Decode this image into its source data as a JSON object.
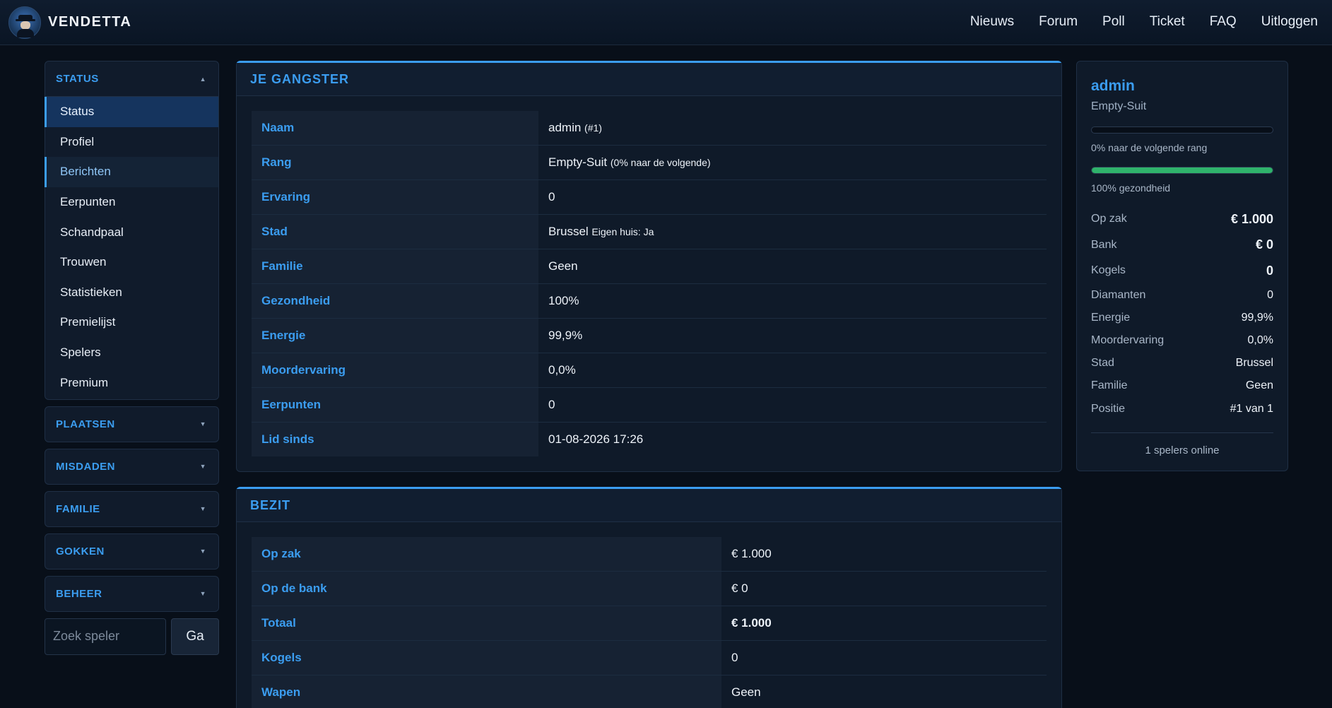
{
  "header": {
    "brand": "VENDETTA",
    "nav": [
      "Nieuws",
      "Forum",
      "Poll",
      "Ticket",
      "FAQ",
      "Uitloggen"
    ]
  },
  "sidebar": {
    "status": {
      "title": "STATUS",
      "items": [
        "Status",
        "Profiel",
        "Berichten",
        "Eerpunten",
        "Schandpaal",
        "Trouwen",
        "Statistieken",
        "Premielijst",
        "Spelers",
        "Premium"
      ]
    },
    "sections": [
      "PLAATSEN",
      "MISDADEN",
      "FAMILIE",
      "GOKKEN",
      "BEHEER"
    ],
    "search": {
      "placeholder": "Zoek speler",
      "button": "Ga"
    }
  },
  "gangster": {
    "title": "JE GANGSTER",
    "rows": [
      {
        "key": "Naam",
        "value": "admin",
        "note": "(#1)"
      },
      {
        "key": "Rang",
        "value": "Empty-Suit",
        "note": "(0% naar de volgende)"
      },
      {
        "key": "Ervaring",
        "value": "0",
        "note": ""
      },
      {
        "key": "Stad",
        "value": "Brussel",
        "note": "Eigen huis: Ja"
      },
      {
        "key": "Familie",
        "value": "Geen",
        "note": ""
      },
      {
        "key": "Gezondheid",
        "value": "100%",
        "note": ""
      },
      {
        "key": "Energie",
        "value": "99,9%",
        "note": ""
      },
      {
        "key": "Moordervaring",
        "value": "0,0%",
        "note": ""
      },
      {
        "key": "Eerpunten",
        "value": "0",
        "note": ""
      },
      {
        "key": "Lid sinds",
        "value": "01-08-2026 17:26",
        "note": ""
      }
    ]
  },
  "bezit": {
    "title": "BEZIT",
    "rows": [
      {
        "key": "Op zak",
        "value": "€ 1.000"
      },
      {
        "key": "Op de bank",
        "value": "€ 0"
      },
      {
        "key": "Totaal",
        "value": "€ 1.000"
      },
      {
        "key": "Kogels",
        "value": "0"
      },
      {
        "key": "Wapen",
        "value": "Geen"
      }
    ]
  },
  "profile": {
    "name": "admin",
    "rank": "Empty-Suit",
    "rank_progress": 0,
    "rank_label": "0% naar de volgende rang",
    "health": 100,
    "health_label": "100% gezondheid",
    "stats": [
      {
        "key": "Op zak",
        "value": "€ 1.000"
      },
      {
        "key": "Bank",
        "value": "€ 0"
      },
      {
        "key": "Kogels",
        "value": "0"
      },
      {
        "key": "Diamanten",
        "value": "0"
      },
      {
        "key": "Energie",
        "value": "99,9%"
      },
      {
        "key": "Moordervaring",
        "value": "0,0%"
      },
      {
        "key": "Stad",
        "value": "Brussel"
      },
      {
        "key": "Familie",
        "value": "Geen"
      },
      {
        "key": "Positie",
        "value": "#1 van 1"
      }
    ],
    "online": "1 spelers online"
  },
  "colors": {
    "accent": "#3b9df0",
    "health": "#2fb36b",
    "background": "#080f19"
  }
}
